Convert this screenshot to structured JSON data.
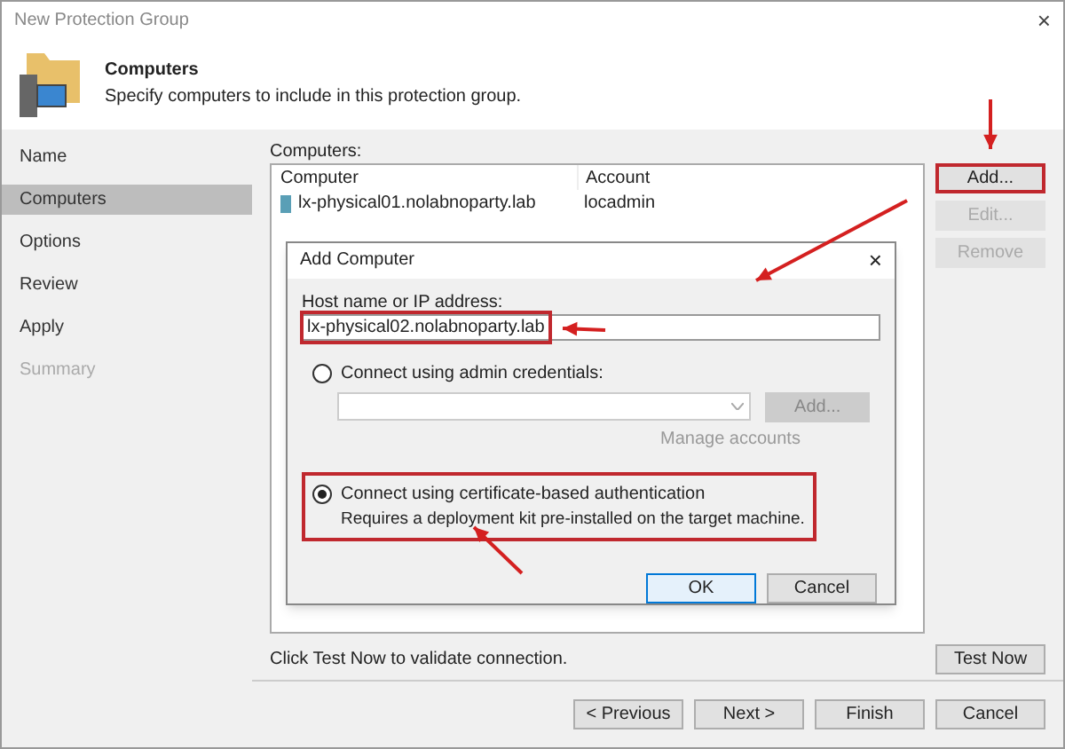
{
  "window": {
    "title": "New Protection Group",
    "close": "×"
  },
  "header": {
    "title": "Computers",
    "subtitle": "Specify computers to include in this protection group."
  },
  "sidebar": {
    "items": [
      {
        "label": "Name",
        "selected": false,
        "disabled": false
      },
      {
        "label": "Computers",
        "selected": true,
        "disabled": false
      },
      {
        "label": "Options",
        "selected": false,
        "disabled": false
      },
      {
        "label": "Review",
        "selected": false,
        "disabled": false
      },
      {
        "label": "Apply",
        "selected": false,
        "disabled": false
      },
      {
        "label": "Summary",
        "selected": false,
        "disabled": true
      }
    ]
  },
  "computers": {
    "label": "Computers:",
    "columns": [
      "Computer",
      "Account"
    ],
    "rows": [
      {
        "computer": "lx-physical01.nolabnoparty.lab",
        "account": "locadmin"
      }
    ],
    "buttons": [
      {
        "label": "Add...",
        "disabled": false,
        "highlighted": true
      },
      {
        "label": "Edit...",
        "disabled": true,
        "highlighted": false
      },
      {
        "label": "Remove",
        "disabled": true,
        "highlighted": false
      }
    ]
  },
  "hint": "Click Test Now to validate connection.",
  "test_button": "Test Now",
  "footer_buttons": [
    "< Previous",
    "Next >",
    "Finish",
    "Cancel"
  ],
  "dialog": {
    "title": "Add Computer",
    "close": "×",
    "host": {
      "label": "Host name or IP address:",
      "value": "lx-physical02.nolabnoparty.lab",
      "highlighted": true
    },
    "options": [
      {
        "label": "Connect using admin credentials:",
        "selected": false,
        "highlighted": false,
        "add_button": "Add...",
        "link": "Manage accounts"
      },
      {
        "label": "Connect using certificate-based authentication",
        "selected": true,
        "highlighted": true,
        "note": "Requires a deployment kit pre-installed on the target machine."
      }
    ],
    "buttons": [
      {
        "label": "OK",
        "default": true
      },
      {
        "label": "Cancel",
        "default": false
      }
    ]
  }
}
